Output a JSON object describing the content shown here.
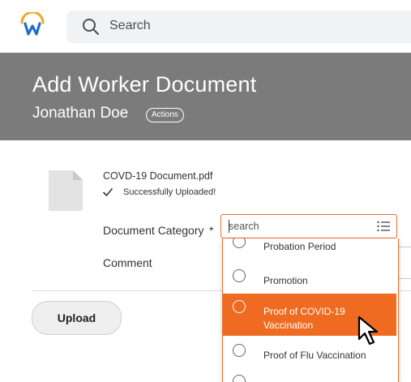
{
  "topbar": {
    "logo_icon": "workday-logo-icon",
    "search": {
      "icon": "search-icon",
      "placeholder": "Search"
    }
  },
  "header": {
    "title": "Add Worker Document",
    "worker_name": "Jonathan Doe",
    "actions_label": "Actions",
    "background": "#7b7b7b"
  },
  "file": {
    "icon": "document-icon",
    "name": "COVD-19 Document.pdf",
    "status": "Successfully Uploaded!"
  },
  "form": {
    "category_label": "Document Category",
    "required_marker": "*",
    "comment_label": "Comment",
    "upload_label": "Upload"
  },
  "dropdown": {
    "search_placeholder": "search",
    "accent": "#f06b22",
    "options": [
      {
        "label": "Probation Period",
        "selected": false
      },
      {
        "label": "Promotion",
        "selected": false
      },
      {
        "label_line1": "Proof of COVID-19",
        "label_line2": "Vaccination",
        "selected": true
      },
      {
        "label": "Proof of Flu Vaccination",
        "selected": false
      }
    ]
  }
}
